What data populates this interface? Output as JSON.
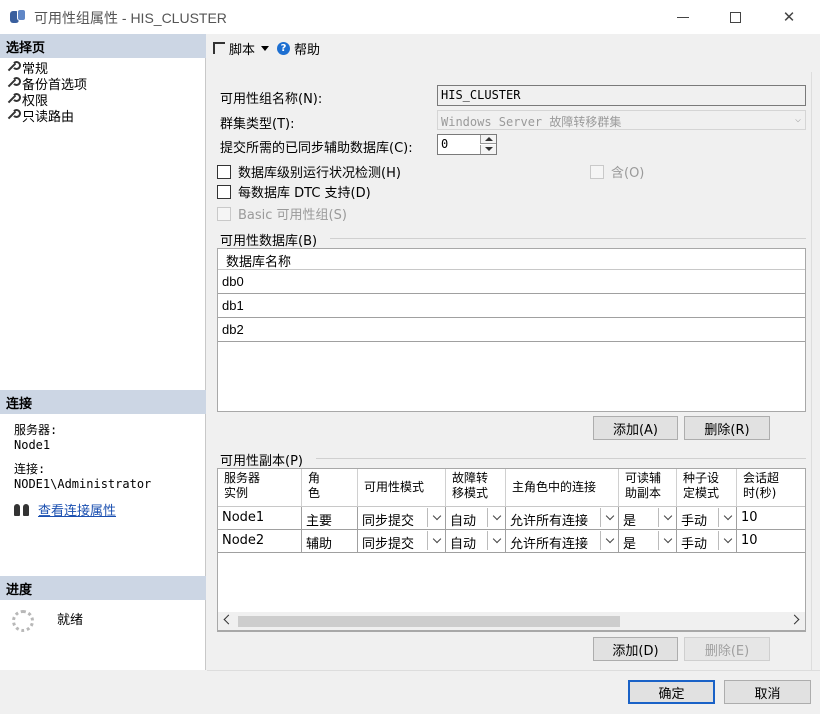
{
  "window": {
    "title": "可用性组属性 - HIS_CLUSTER"
  },
  "left_pane": {
    "select_page_header": "选择页",
    "pages": [
      {
        "label": "常规"
      },
      {
        "label": "备份首选项"
      },
      {
        "label": "权限"
      },
      {
        "label": "只读路由"
      }
    ],
    "connection_header": "连接",
    "server_label": "服务器:",
    "server_value": "Node1",
    "connection_label": "连接:",
    "connection_value": "NODE1\\Administrator",
    "view_connection_link": "查看连接属性",
    "progress_header": "进度",
    "progress_status": "就绪"
  },
  "toolbar": {
    "script_label": "脚本",
    "help_label": "帮助"
  },
  "form": {
    "ag_name_label": "可用性组名称(N):",
    "ag_name_value": "HIS_CLUSTER",
    "cluster_type_label": "群集类型(T):",
    "cluster_type_value": "Windows Server 故障转移群集",
    "required_sync_label": "提交所需的已同步辅助数据库(C):",
    "required_sync_value": "0",
    "db_health_label": "数据库级别运行状况检测(H)",
    "contained_label": "含(O)",
    "dtc_label": "每数据库 DTC 支持(D)",
    "basic_label": "Basic 可用性组(S)"
  },
  "databases": {
    "group_label": "可用性数据库(B)",
    "column_header": "数据库名称",
    "rows": [
      "db0",
      "db1",
      "db2"
    ],
    "add_button": "添加(A)",
    "remove_button": "删除(R)"
  },
  "replicas": {
    "group_label": "可用性副本(P)",
    "headers": [
      "服务器实例",
      "角色",
      "可用性模式",
      "故障转移模式",
      "主角色中的连接",
      "可读辅助副本",
      "种子设定模式",
      "会话超时(秒)"
    ],
    "header_lines": [
      [
        "服务器",
        "实例"
      ],
      [
        "角",
        "色"
      ],
      [
        "可用性模式"
      ],
      [
        "故障转",
        "移模式"
      ],
      [
        "主角色中的连接"
      ],
      [
        "可读辅",
        "助副本"
      ],
      [
        "种子设",
        "定模式"
      ],
      [
        "会话超",
        "时(秒)"
      ]
    ],
    "rows": [
      {
        "server": "Node1",
        "role": "主要",
        "availability_mode": "同步提交",
        "failover_mode": "自动",
        "primary_connections": "允许所有连接",
        "readable_secondary": "是",
        "seeding_mode": "手动",
        "session_timeout": "10"
      },
      {
        "server": "Node2",
        "role": "辅助",
        "availability_mode": "同步提交",
        "failover_mode": "自动",
        "primary_connections": "允许所有连接",
        "readable_secondary": "是",
        "seeding_mode": "手动",
        "session_timeout": "10"
      }
    ],
    "add_button": "添加(D)",
    "remove_button": "删除(E)"
  },
  "dialog_buttons": {
    "ok": "确定",
    "cancel": "取消"
  }
}
